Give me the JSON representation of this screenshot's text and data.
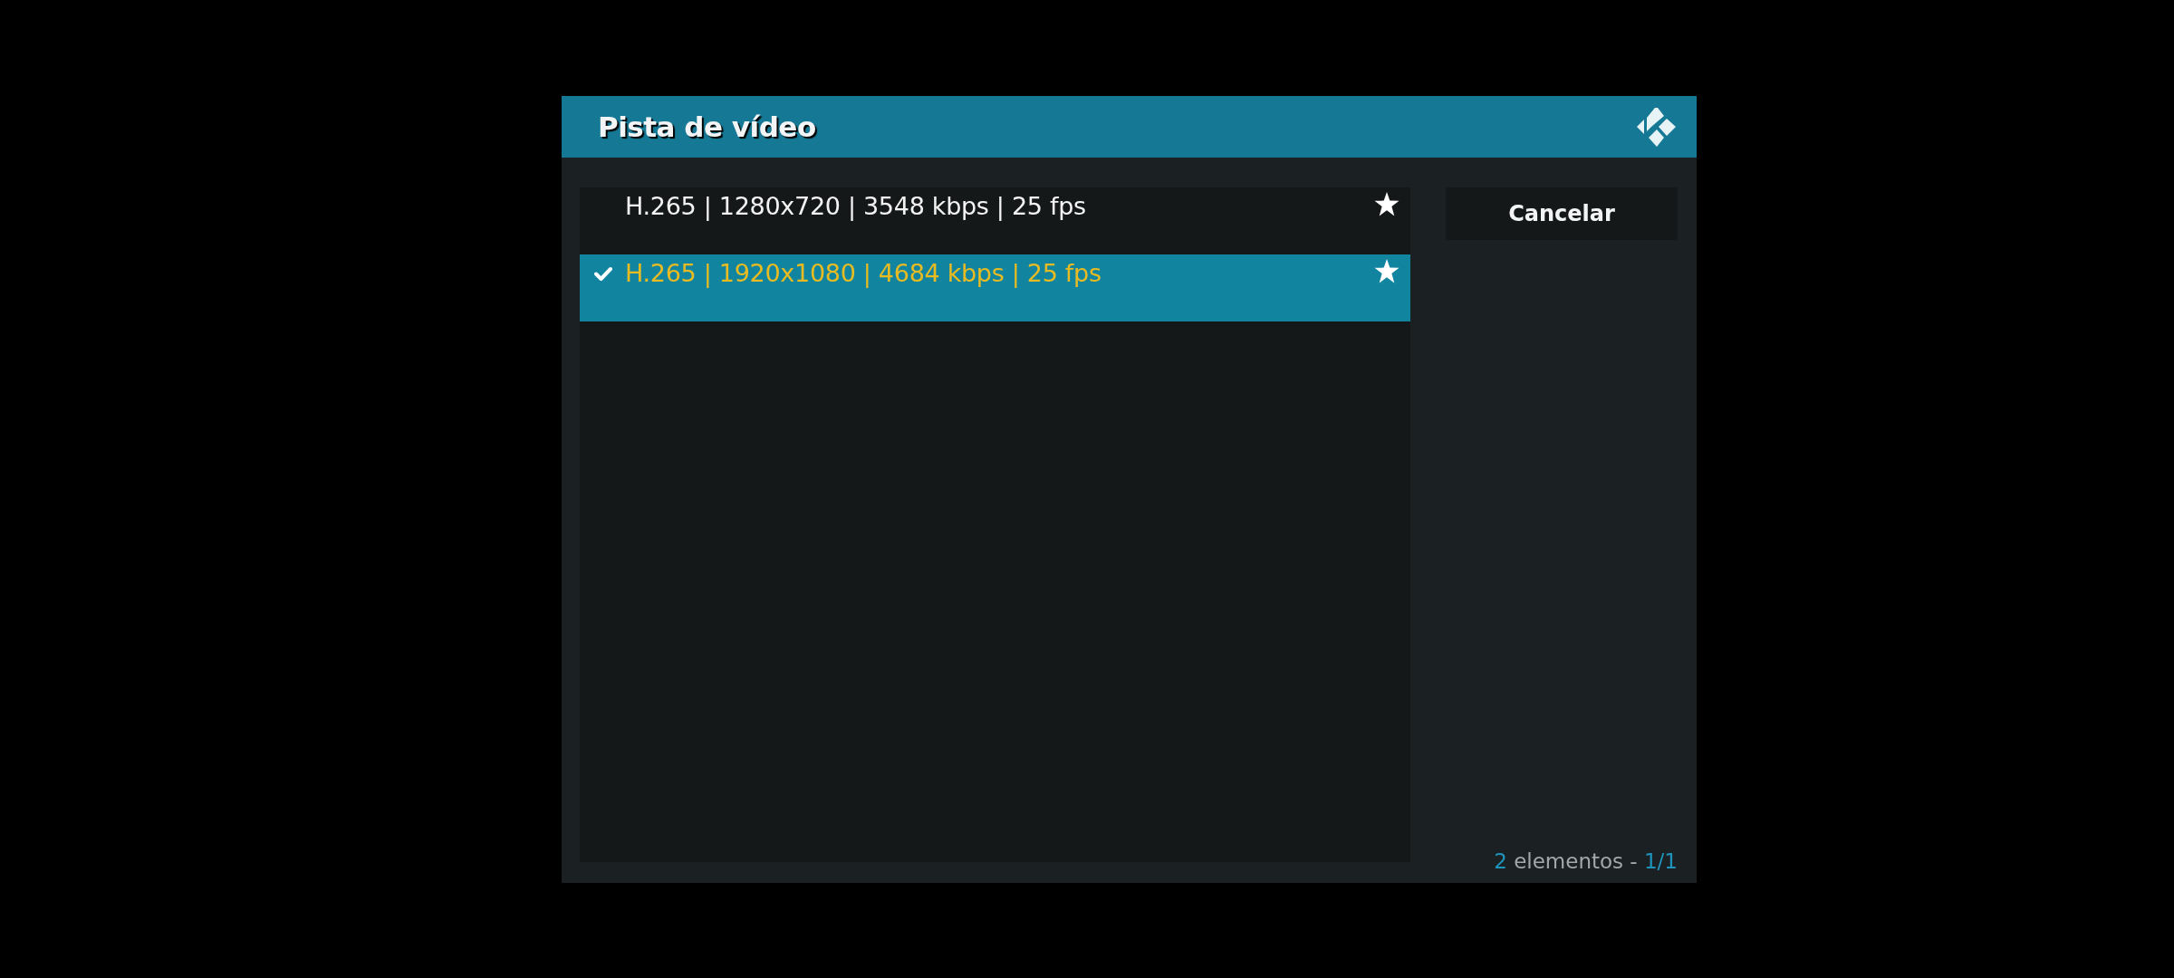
{
  "dialog": {
    "title": "Pista de vídeo"
  },
  "tracks": [
    {
      "label": "H.265 | 1280x720 | 3548 kbps | 25 fps",
      "selected": false,
      "checked": false,
      "starred": true
    },
    {
      "label": "H.265 | 1920x1080 | 4684 kbps | 25 fps",
      "selected": true,
      "checked": true,
      "starred": true
    }
  ],
  "buttons": [
    {
      "label": "Cancelar"
    }
  ],
  "footer": {
    "count": "2",
    "label": "elementos -",
    "page": "1/1"
  }
}
